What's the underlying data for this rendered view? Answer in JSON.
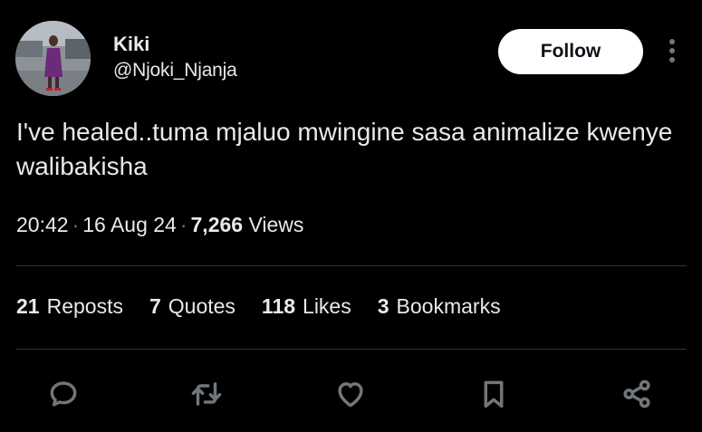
{
  "author": {
    "display_name": "Kiki",
    "handle": "@Njoki_Njanja"
  },
  "follow_button": {
    "label": "Follow"
  },
  "tweet": {
    "text": "I've healed..tuma mjaluo mwingine sasa animalize kwenye walibakisha"
  },
  "meta": {
    "time": "20:42",
    "date": "16 Aug 24",
    "views_count": "7,266",
    "views_label": "Views"
  },
  "stats": [
    {
      "count": "21",
      "label": "Reposts"
    },
    {
      "count": "7",
      "label": "Quotes"
    },
    {
      "count": "118",
      "label": "Likes"
    },
    {
      "count": "3",
      "label": "Bookmarks"
    }
  ],
  "actions": [
    "reply-icon",
    "retweet-icon",
    "like-icon",
    "bookmark-icon",
    "share-icon"
  ],
  "colors": {
    "background": "#000000",
    "text": "#e7e9ea",
    "muted": "#71767b",
    "divider": "#2f3336",
    "follow_bg": "#ffffff"
  }
}
